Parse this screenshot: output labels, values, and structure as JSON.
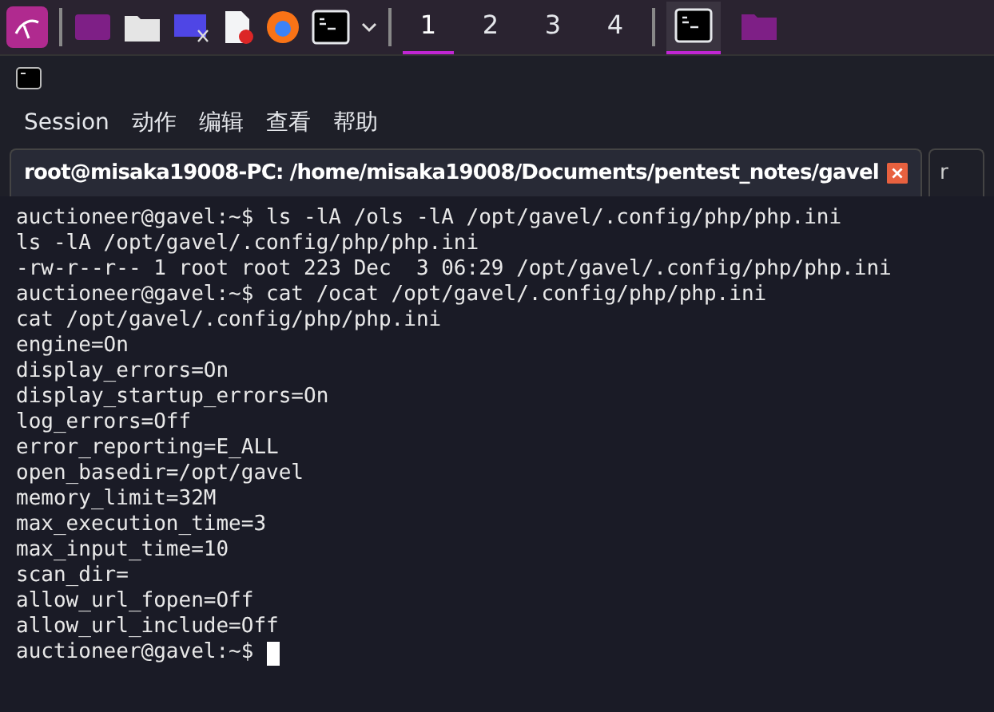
{
  "taskbar": {
    "workspaces": [
      {
        "label": "1",
        "selected": true
      },
      {
        "label": "2",
        "selected": false
      },
      {
        "label": "3",
        "selected": false
      },
      {
        "label": "4",
        "selected": false
      }
    ],
    "tasks": [
      {
        "kind": "terminal",
        "selected": true
      },
      {
        "kind": "folder",
        "selected": false
      }
    ]
  },
  "menu": [
    "Session",
    "动作",
    "编辑",
    "查看",
    "帮助"
  ],
  "tabs": [
    {
      "label": "root@misaka19008-PC: /home/misaka19008/Documents/pentest_notes/gavel",
      "selected": true
    },
    {
      "label": "r",
      "selected": false
    }
  ],
  "terminal": {
    "lines": [
      "auctioneer@gavel:~$ ls -lA /ols -lA /opt/gavel/.config/php/php.ini",
      "ls -lA /opt/gavel/.config/php/php.ini",
      "-rw-r--r-- 1 root root 223 Dec  3 06:29 /opt/gavel/.config/php/php.ini",
      "auctioneer@gavel:~$ cat /ocat /opt/gavel/.config/php/php.ini",
      "cat /opt/gavel/.config/php/php.ini",
      "engine=On",
      "display_errors=On",
      "display_startup_errors=On",
      "log_errors=Off",
      "error_reporting=E_ALL",
      "open_basedir=/opt/gavel",
      "memory_limit=32M",
      "max_execution_time=3",
      "max_input_time=10",
      "scan_dir=",
      "allow_url_fopen=Off",
      "allow_url_include=Off"
    ],
    "prompt": "auctioneer@gavel:~$"
  }
}
